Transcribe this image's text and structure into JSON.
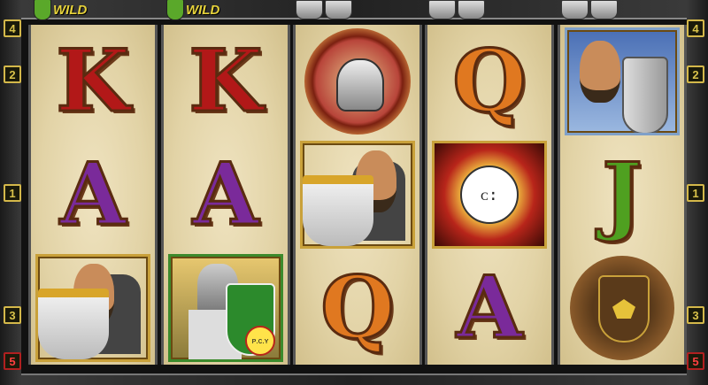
{
  "header": {
    "wild_label": "WILD",
    "wild_badges": [
      {
        "label": "WILD",
        "icon": "green-shield-icon"
      },
      {
        "label": "WILD",
        "icon": "green-shield-icon"
      }
    ],
    "knight_badges": [
      "grey-shield-icon",
      "grey-shield-icon",
      "grey-shield-icon"
    ]
  },
  "paylines": {
    "left": [
      "4",
      "2",
      "1",
      "3",
      "5"
    ],
    "right": [
      "4",
      "2",
      "1",
      "3",
      "5"
    ]
  },
  "reels": [
    {
      "symbols": [
        {
          "type": "letter",
          "text": "K",
          "color": "#b21818"
        },
        {
          "type": "letter",
          "text": "A",
          "color": "#7a2a9a"
        },
        {
          "type": "image",
          "name": "bearded-knight-symbol"
        }
      ]
    },
    {
      "symbols": [
        {
          "type": "letter",
          "text": "K",
          "color": "#b21818"
        },
        {
          "type": "letter",
          "text": "A",
          "color": "#7a2a9a"
        },
        {
          "type": "image",
          "name": "armored-knight-wild-symbol",
          "sun_text": "ᴘ.ᴄ.ʏ"
        }
      ]
    },
    {
      "symbols": [
        {
          "type": "image",
          "name": "helmet-symbol"
        },
        {
          "type": "image",
          "name": "bearded-knight-symbol"
        },
        {
          "type": "letter",
          "text": "Q",
          "color": "#e07820"
        }
      ]
    },
    {
      "symbols": [
        {
          "type": "letter",
          "text": "Q",
          "color": "#e07820"
        },
        {
          "type": "image",
          "name": "sun-scatter-symbol",
          "face_text": "ᴄ:"
        },
        {
          "type": "letter",
          "text": "A",
          "color": "#7a2a9a"
        }
      ]
    },
    {
      "symbols": [
        {
          "type": "image",
          "name": "knight-portrait-symbol"
        },
        {
          "type": "letter",
          "text": "J",
          "color": "#4fa020"
        },
        {
          "type": "image",
          "name": "shield-crest-symbol"
        }
      ]
    }
  ]
}
